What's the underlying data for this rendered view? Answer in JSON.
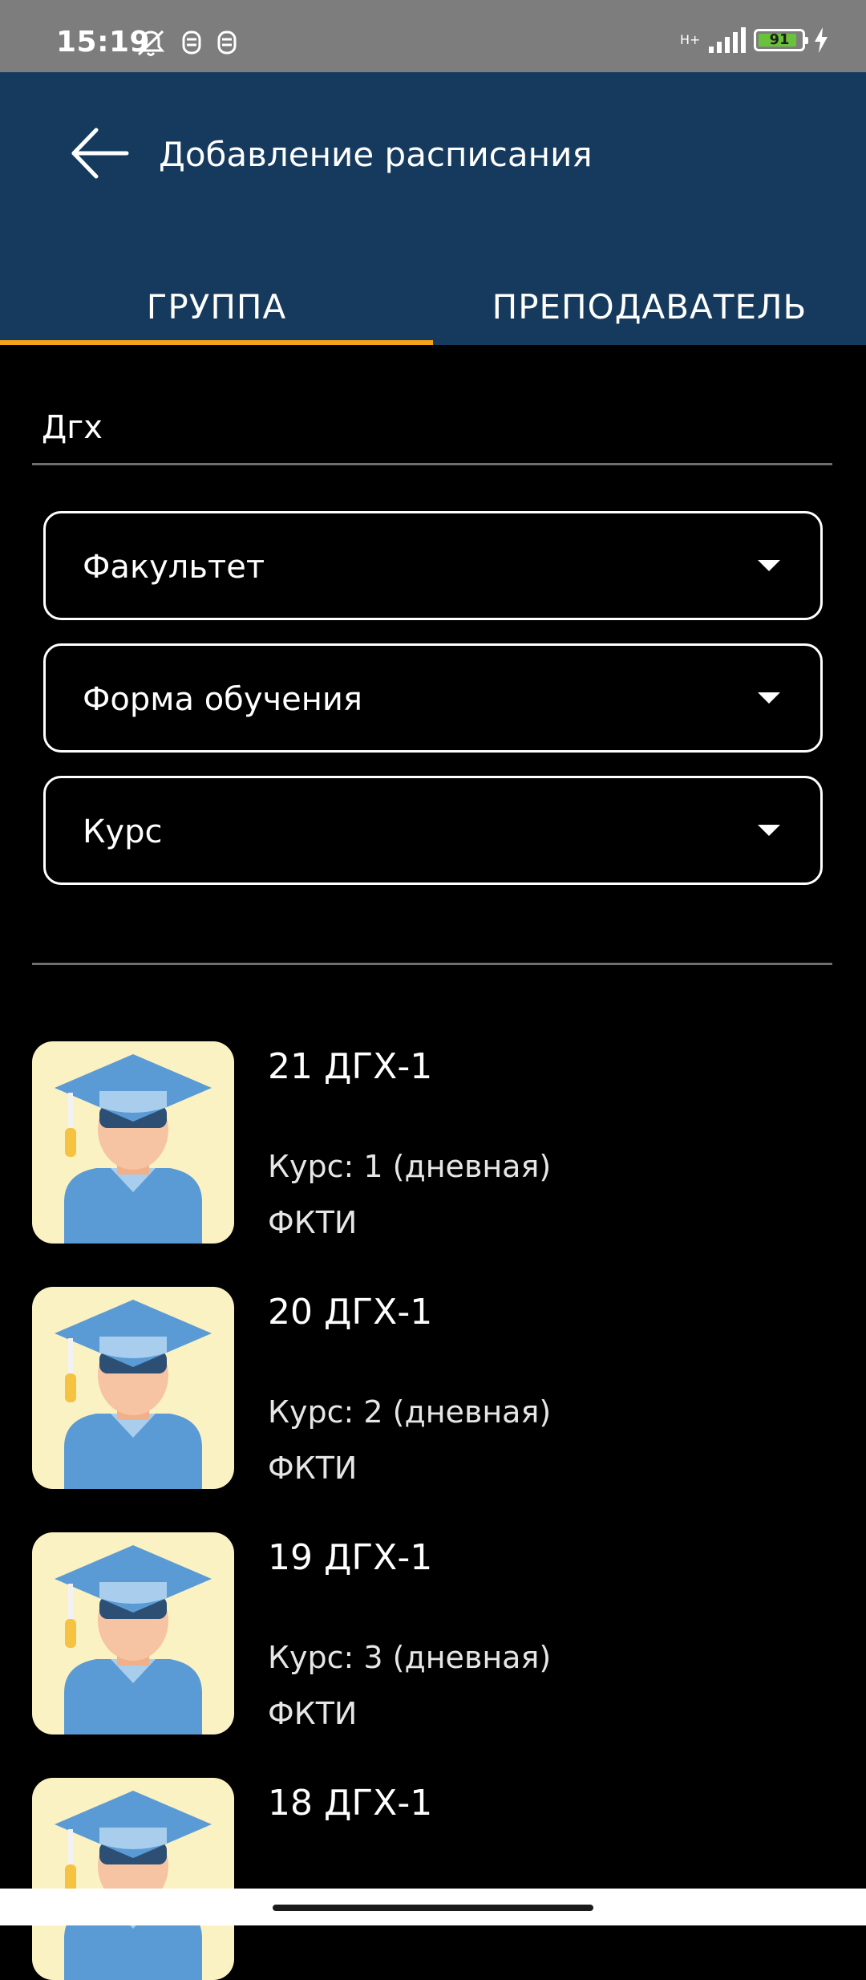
{
  "status_bar": {
    "time": "15:19",
    "network_type": "H+",
    "battery_level": "91",
    "battery_fraction": 0.91,
    "icons": [
      "mute-icon",
      "alarm-icon",
      "alarm-icon",
      "signal-icon",
      "battery-icon",
      "charging-icon"
    ]
  },
  "app_bar": {
    "title": "Добавление расписания",
    "back_icon": "arrow-left-icon",
    "background_color": "#153a5e"
  },
  "tabs": [
    {
      "label": "ГРУППА",
      "active": true
    },
    {
      "label": "ПРЕПОДАВАТЕЛЬ",
      "active": false
    }
  ],
  "accent_color": "#f5a31a",
  "search": {
    "value": "Дгх",
    "placeholder": ""
  },
  "filters": [
    {
      "label": "Факультет",
      "icon": "caret-down-icon"
    },
    {
      "label": "Форма обучения",
      "icon": "caret-down-icon"
    },
    {
      "label": "Курс",
      "icon": "caret-down-icon"
    }
  ],
  "groups": [
    {
      "name": "21 ДГХ-1",
      "course": "Курс: 1 (дневная)",
      "faculty": "ФКТИ",
      "avatar_icon": "graduate-student-icon"
    },
    {
      "name": "20 ДГХ-1",
      "course": "Курс: 2 (дневная)",
      "faculty": "ФКТИ",
      "avatar_icon": "graduate-student-icon"
    },
    {
      "name": "19 ДГХ-1",
      "course": "Курс: 3 (дневная)",
      "faculty": "ФКТИ",
      "avatar_icon": "graduate-student-icon"
    },
    {
      "name": "18 ДГХ-1",
      "course": "",
      "faculty": "",
      "avatar_icon": "graduate-student-icon"
    }
  ]
}
